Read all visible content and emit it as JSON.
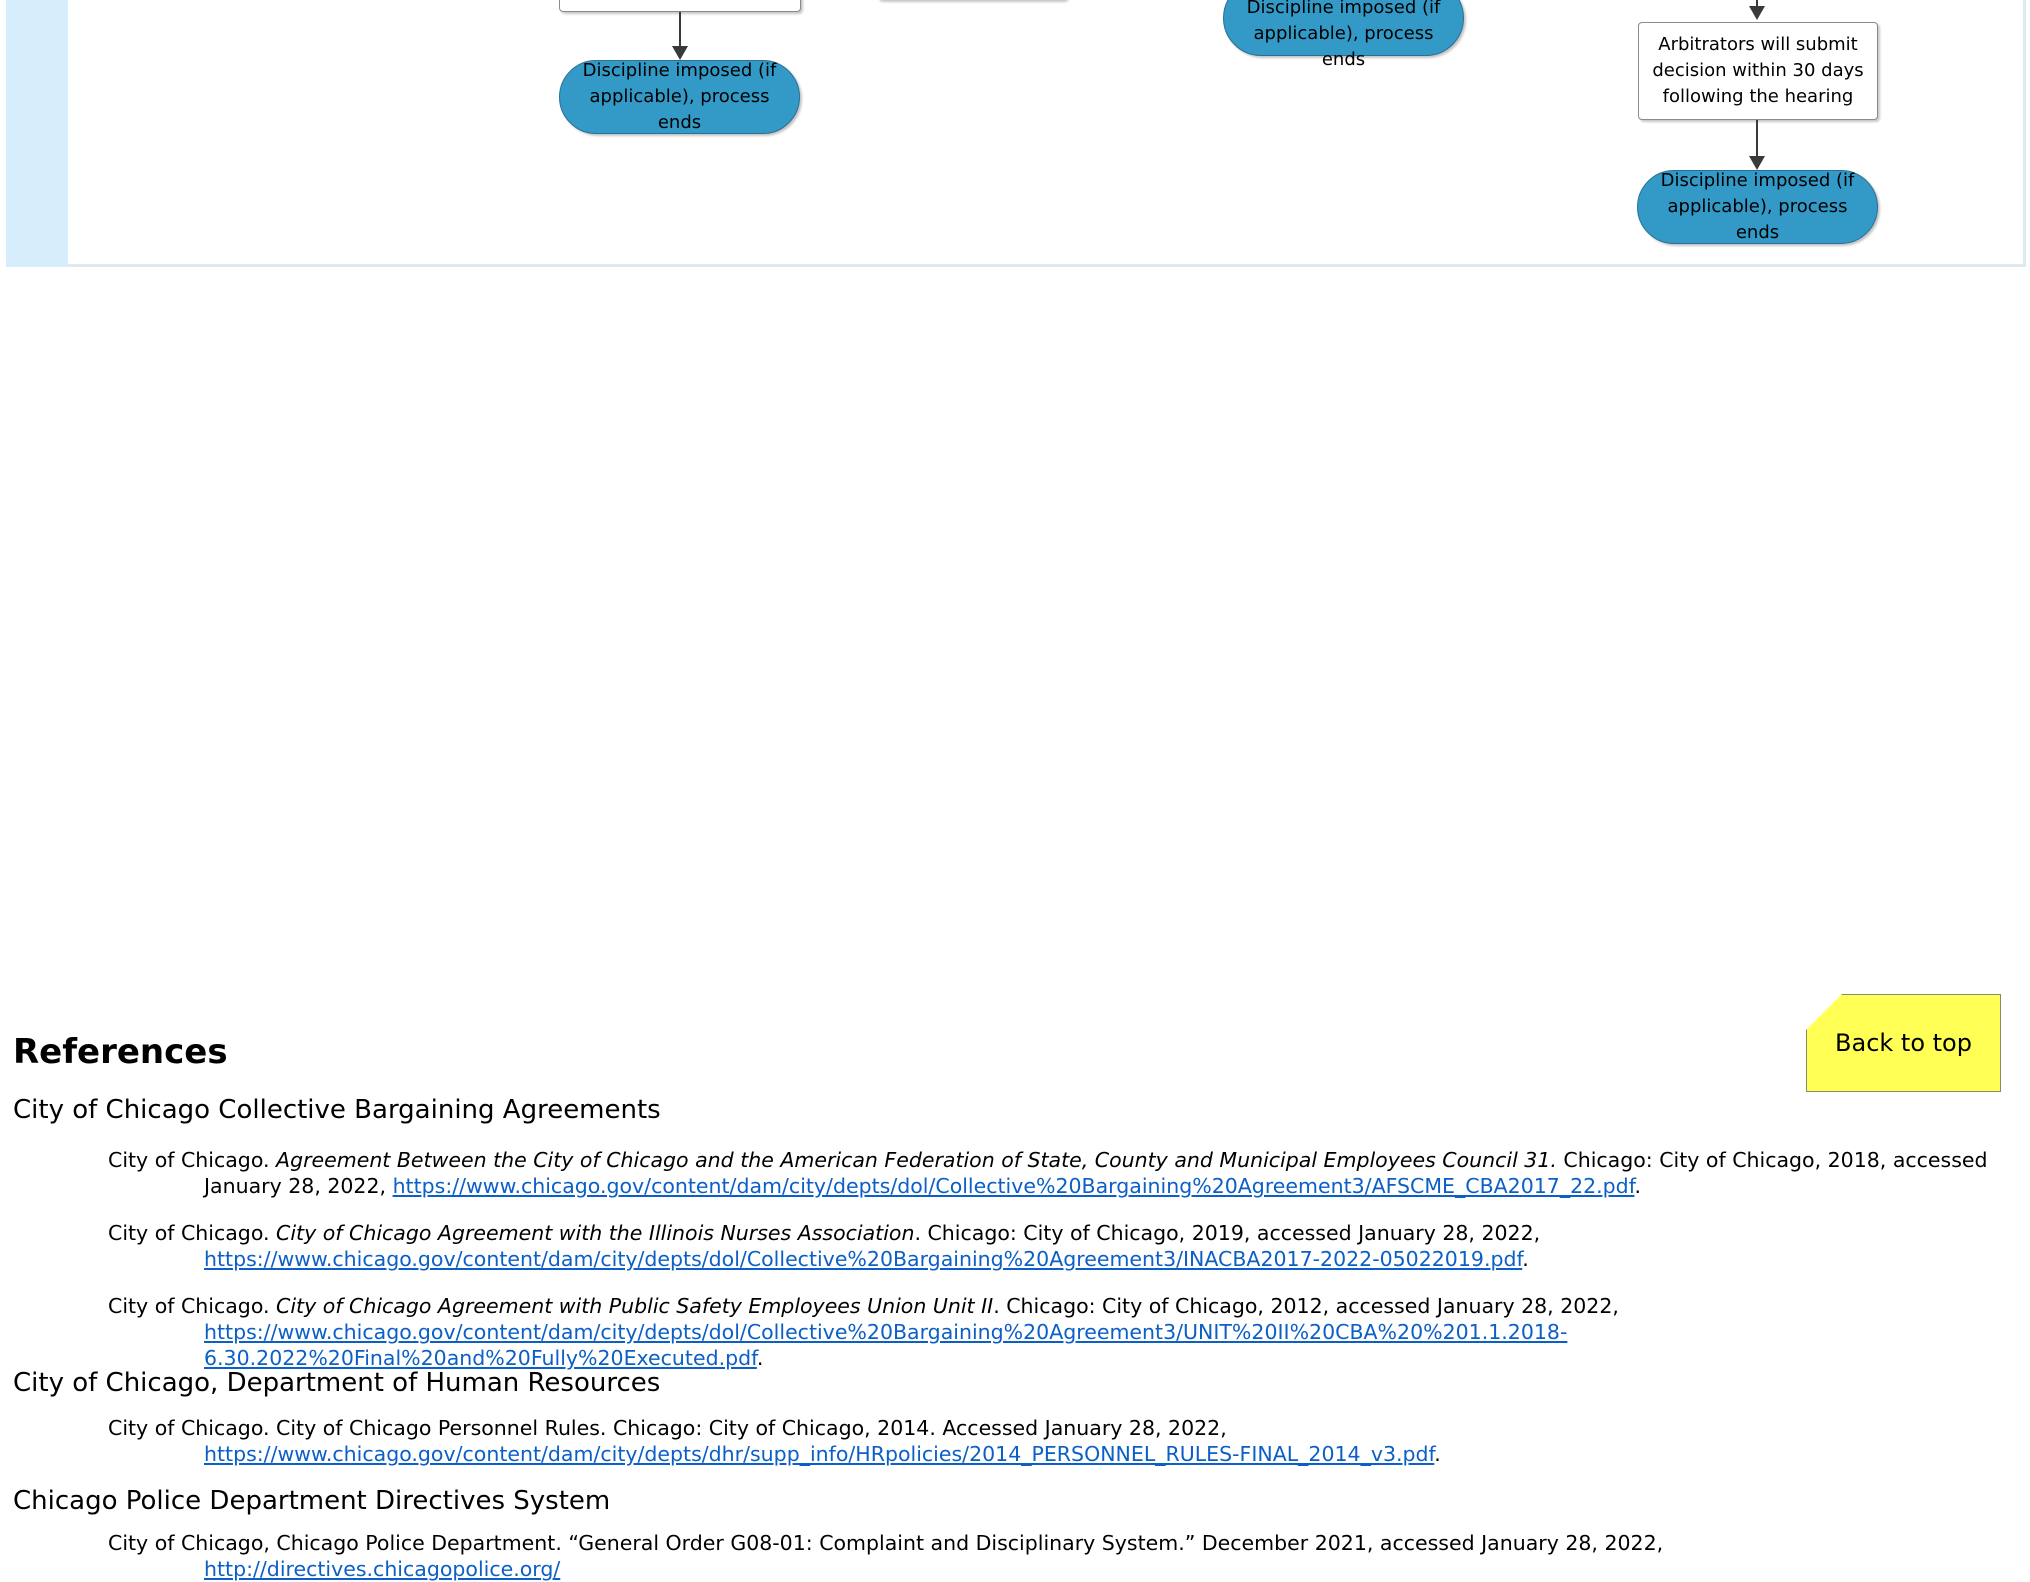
{
  "flowchart": {
    "left_column": {
      "end_node": "Discipline imposed (if applicable), process ends"
    },
    "middle_column": {
      "end_node": "Discipline imposed (if applicable), process ends"
    },
    "right_column": {
      "step_box": "Arbitrators will submit decision within 30 days following the hearing",
      "end_node": "Discipline imposed (if applicable), process ends"
    },
    "colors": {
      "terminal_fill": "#3399c6",
      "side_stripe": "#d6eefb"
    }
  },
  "back_to_top": {
    "label": "Back to top",
    "color": "#ffff55"
  },
  "references": {
    "heading": "References",
    "sections": [
      {
        "title": "City of Chicago Collective Bargaining Agreements",
        "entries": [
          {
            "prefix": "City of Chicago. ",
            "italic": "Agreement Between the City of Chicago and the American Federation of State, County and Municipal Employees Council 31.",
            "after": " Chicago: City of Chicago, 2018, accessed January 28, 2022, ",
            "url": "https://www.chicago.gov/content/dam/city/depts/dol/Collective%20Bargaining%20Agreement3/AFSCME_CBA2017_22.pdf",
            "end": "."
          },
          {
            "prefix": "City of Chicago. ",
            "italic": "City of Chicago Agreement with the Illinois Nurses Association",
            "after": ". Chicago: City of Chicago, 2019, accessed January 28, 2022, ",
            "url": "https://www.chicago.gov/content/dam/city/depts/dol/Collective%20Bargaining%20Agreement3/INACBA2017-2022-05022019.pdf",
            "end": "."
          },
          {
            "prefix": "City of Chicago. ",
            "italic": "City of Chicago Agreement with Public Safety Employees Union Unit II",
            "after": ". Chicago: City of Chicago, 2012, accessed January 28, 2022, ",
            "url": "https://www.chicago.gov/content/dam/city/depts/dol/Collective%20Bargaining%20Agreement3/UNIT%20II%20CBA%20%201.1.2018-6.30.2022%20Final%20and%20Fully%20Executed.pdf",
            "end": "."
          }
        ]
      },
      {
        "title": "City of Chicago, Department of Human Resources",
        "entries": [
          {
            "prefix": "City of Chicago. City of Chicago Personnel Rules. Chicago: City of Chicago, 2014. Accessed January 28, 2022, ",
            "italic": "",
            "after": "",
            "url": "https://www.chicago.gov/content/dam/city/depts/dhr/supp_info/HRpolicies/2014_PERSONNEL_RULES-FINAL_2014_v3.pdf",
            "end": "."
          }
        ]
      },
      {
        "title": "Chicago Police Department Directives System",
        "entries": [
          {
            "prefix": "City of Chicago, Chicago Police Department. “General Order G08-01: Complaint and Disciplinary System.” December 2021, accessed January 28, 2022, ",
            "italic": "",
            "after": "",
            "url": "http://directives.chicagopolice.org/",
            "end": ""
          }
        ]
      }
    ]
  }
}
